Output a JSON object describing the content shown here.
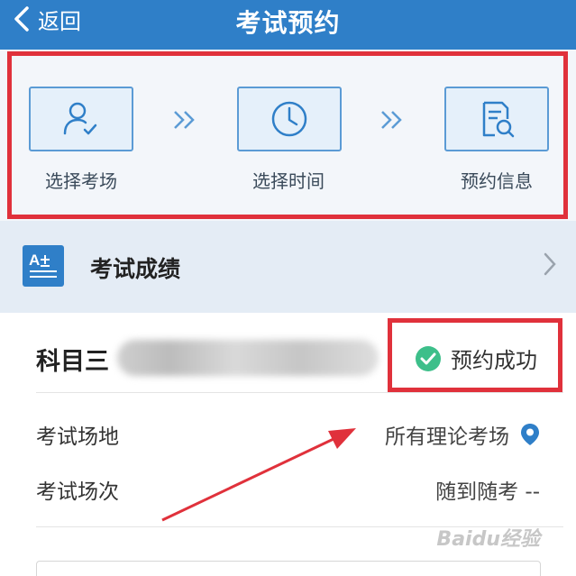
{
  "header": {
    "back_label": "返回",
    "title": "考试预约"
  },
  "steps": [
    {
      "label": "选择考场",
      "icon": "user-check-icon"
    },
    {
      "label": "选择时间",
      "icon": "clock-icon"
    },
    {
      "label": "预约信息",
      "icon": "document-search-icon"
    }
  ],
  "score_row": {
    "label": "考试成绩",
    "icon": "grade-icon"
  },
  "card": {
    "subject": "科目三",
    "status": "预约成功",
    "rows": [
      {
        "label": "考试场地",
        "value": "所有理论考场"
      },
      {
        "label": "考试场次",
        "value": "随到随考 --"
      }
    ]
  },
  "watermark": "Baidu经验",
  "colors": {
    "header": "#2f7fc8",
    "annotation": "#e0313b",
    "success": "#3dbf8a"
  }
}
